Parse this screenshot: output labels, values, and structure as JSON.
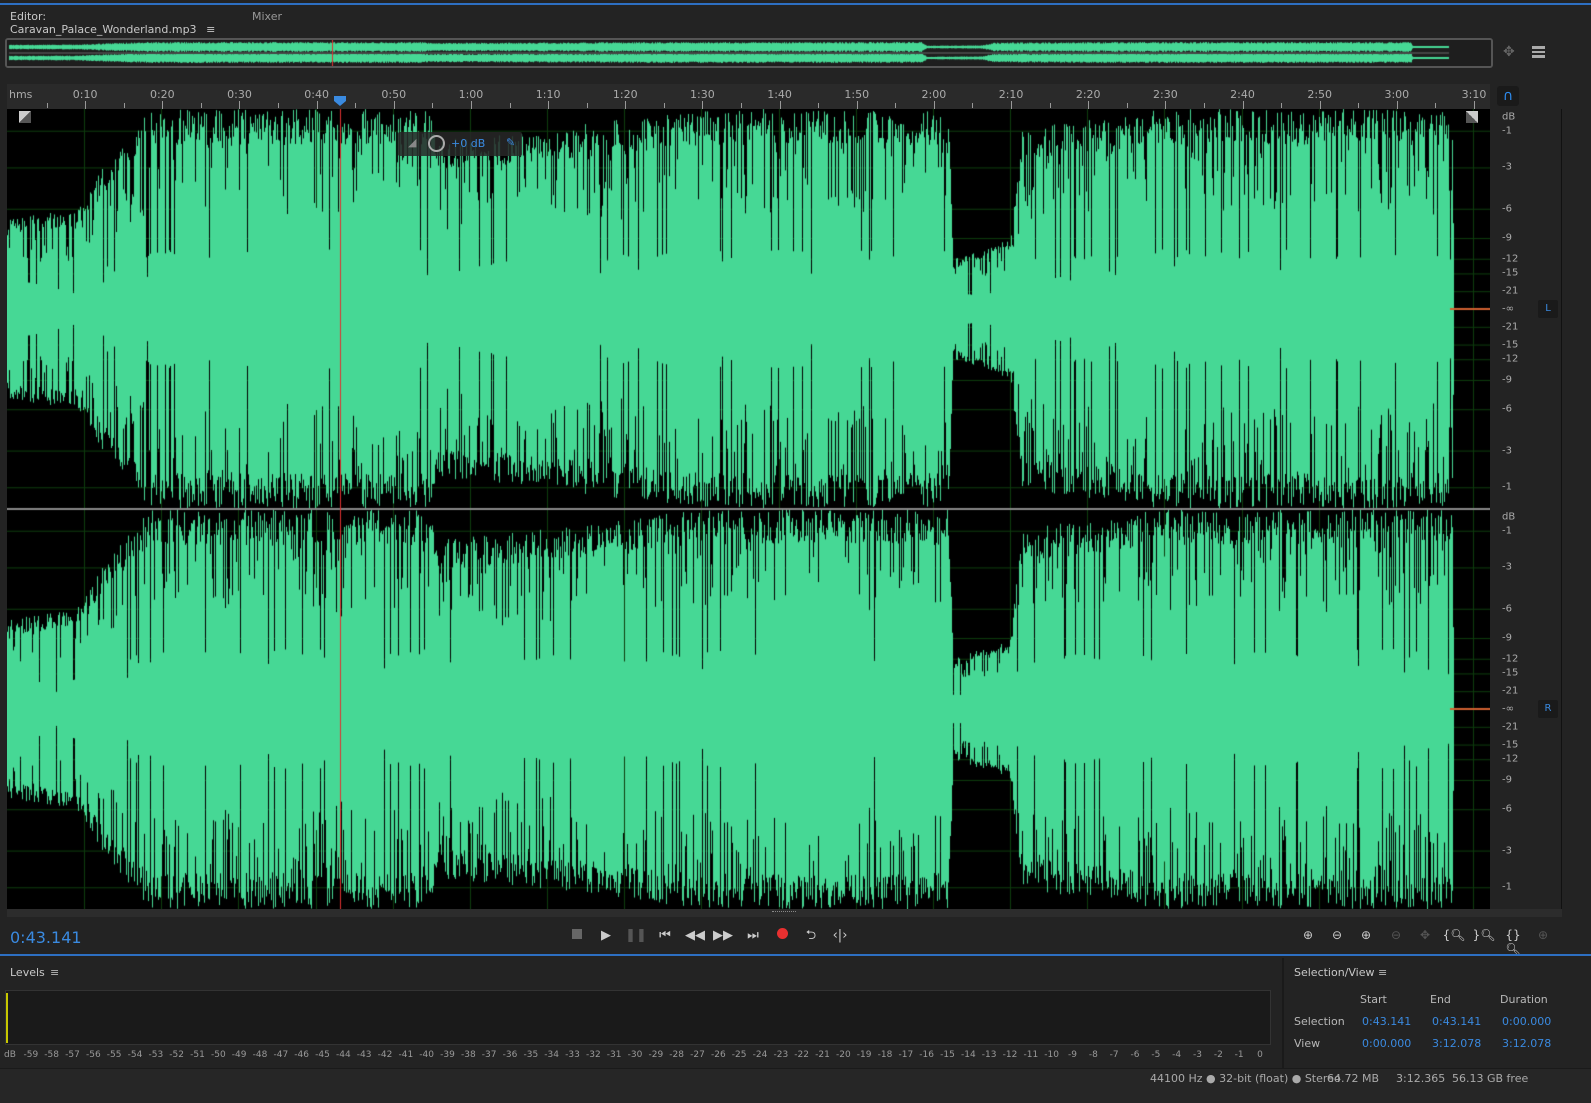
{
  "tabs": {
    "editor": "Editor: Caravan_Palace_Wonderland.mp3",
    "menu_icon": "≡",
    "mixer": "Mixer"
  },
  "ruler": {
    "unit": "hms",
    "ticks": [
      "0:10",
      "0:20",
      "0:30",
      "0:40",
      "0:50",
      "1:00",
      "1:10",
      "1:20",
      "1:30",
      "1:40",
      "1:50",
      "2:00",
      "2:10",
      "2:20",
      "2:30",
      "2:40",
      "2:50",
      "3:00",
      "3:10"
    ]
  },
  "hud": {
    "volume": "+0 dB"
  },
  "db_scale": {
    "labels": [
      "dB",
      "-1",
      "-3",
      "-6",
      "-9",
      "-12",
      "-15",
      "-21",
      "-∞",
      "-21",
      "-15",
      "-12",
      "-9",
      "-6",
      "-3",
      "-1"
    ],
    "values": [
      null,
      -1,
      -3,
      -6,
      -9,
      -12,
      -15,
      -21,
      -999,
      -21,
      -15,
      -12,
      -9,
      -6,
      -3,
      -1
    ]
  },
  "channels": {
    "left": "L",
    "right": "R"
  },
  "colors": {
    "waveform": "#46d895",
    "playhead": "#e03030",
    "accent": "#3a8ae0"
  },
  "playhead_seconds": 43.141,
  "duration_seconds": 192.365,
  "transport": {
    "current_time": "0:43.141"
  },
  "levels": {
    "title": "Levels",
    "scale": [
      "dB",
      "-59",
      "-58",
      "-57",
      "-56",
      "-55",
      "-54",
      "-53",
      "-52",
      "-51",
      "-50",
      "-49",
      "-48",
      "-47",
      "-46",
      "-45",
      "-44",
      "-43",
      "-42",
      "-41",
      "-40",
      "-39",
      "-38",
      "-37",
      "-36",
      "-35",
      "-34",
      "-33",
      "-32",
      "-31",
      "-30",
      "-29",
      "-28",
      "-27",
      "-26",
      "-25",
      "-24",
      "-23",
      "-22",
      "-21",
      "-20",
      "-19",
      "-18",
      "-17",
      "-16",
      "-15",
      "-14",
      "-13",
      "-12",
      "-11",
      "-10",
      "-9",
      "-8",
      "-7",
      "-6",
      "-5",
      "-4",
      "-3",
      "-2",
      "-1",
      "0"
    ]
  },
  "selection_view": {
    "title": "Selection/View",
    "headers": [
      "Start",
      "End",
      "Duration"
    ],
    "rows": [
      {
        "label": "Selection",
        "start": "0:43.141",
        "end": "0:43.141",
        "duration": "0:00.000"
      },
      {
        "label": "View",
        "start": "0:00.000",
        "end": "3:12.078",
        "duration": "3:12.078"
      }
    ]
  },
  "status": {
    "format": "44100 Hz ● 32-bit (float) ● Stereo",
    "size": "64.72 MB",
    "duration": "3:12.365",
    "free": "56.13 GB free"
  }
}
